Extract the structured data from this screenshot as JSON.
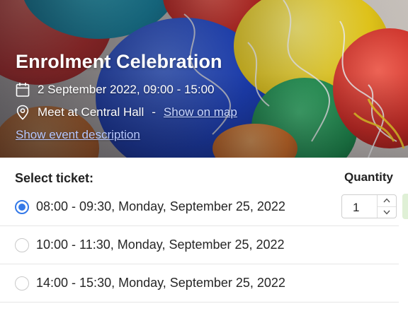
{
  "event": {
    "title": "Enrolment Celebration",
    "datetime": "2 September 2022, 09:00 - 15:00",
    "location": "Meet at Central Hall",
    "separator": "-",
    "map_link": "Show on map",
    "description_link": "Show event description",
    "icons": {
      "date": "calendar-icon",
      "location": "map-pin-icon"
    }
  },
  "tickets": {
    "heading": "Select ticket:",
    "quantity_heading": "Quantity",
    "options": [
      {
        "label": "08:00 - 09:30, Monday, September 25, 2022",
        "selected": true
      },
      {
        "label": "10:00 - 11:30, Monday, September 25, 2022",
        "selected": false
      },
      {
        "label": "14:00 - 15:30, Monday, September 25, 2022",
        "selected": false
      }
    ],
    "quantity": "1"
  },
  "colors": {
    "accent": "#3479e8",
    "link": "#b7c8ff",
    "add_button_edge": "#dff0d6"
  }
}
